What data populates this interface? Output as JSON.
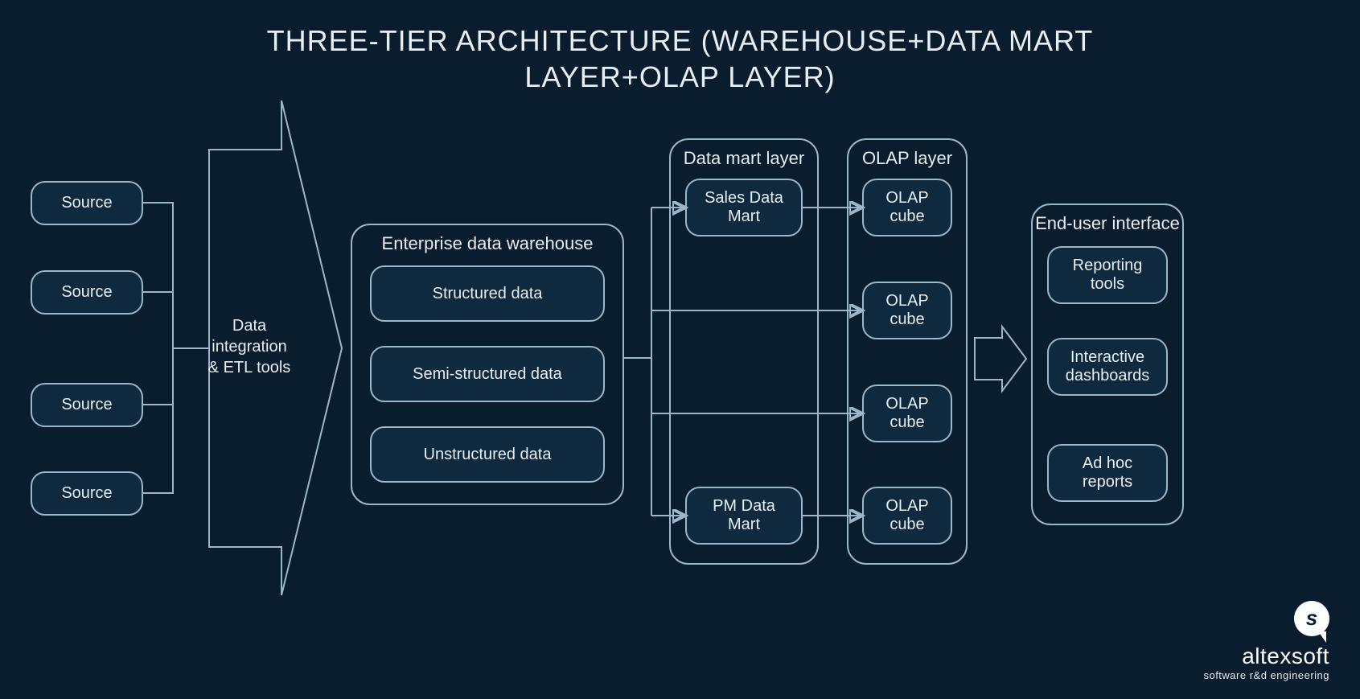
{
  "title_line1": "THREE-TIER ARCHITECTURE (WAREHOUSE+DATA MART",
  "title_line2": "LAYER+OLAP LAYER)",
  "sources": {
    "s1": "Source",
    "s2": "Source",
    "s3": "Source",
    "s4": "Source"
  },
  "etl_label": "Data\nintegration\n& ETL tools",
  "warehouse": {
    "title": "Enterprise data warehouse",
    "items": {
      "structured": "Structured data",
      "semi": "Semi-structured data",
      "unstructured": "Unstructured data"
    }
  },
  "datamart": {
    "title": "Data mart layer",
    "items": {
      "sales": "Sales Data Mart",
      "pm": "PM Data Mart"
    }
  },
  "olap": {
    "title": "OLAP layer",
    "items": {
      "c1": "OLAP cube",
      "c2": "OLAP cube",
      "c3": "OLAP cube",
      "c4": "OLAP cube"
    }
  },
  "enduser": {
    "title": "End-user interface",
    "items": {
      "reporting": "Reporting tools",
      "dashboards": "Interactive dashboards",
      "adhoc": "Ad hoc reports"
    }
  },
  "logo": {
    "brand": "altexsoft",
    "tagline": "software r&d engineering"
  }
}
